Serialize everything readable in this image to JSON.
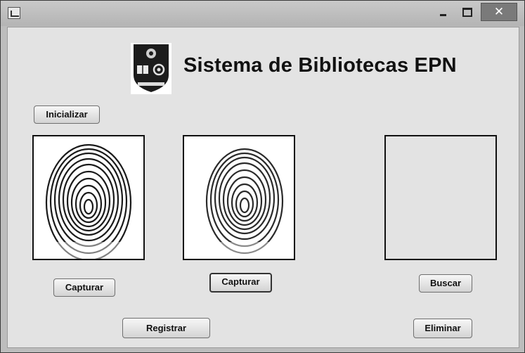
{
  "window": {
    "close_glyph": "✕"
  },
  "header": {
    "title": "Sistema de Bibliotecas EPN"
  },
  "buttons": {
    "initialize": "Inicializar",
    "capture_1": "Capturar",
    "capture_2": "Capturar",
    "search": "Buscar",
    "register": "Registrar",
    "delete": "Eliminar"
  },
  "icons": {
    "app": "java-cup-icon",
    "minimize": "minimize-icon",
    "maximize": "maximize-icon",
    "close": "close-icon",
    "logo": "epn-shield-logo"
  },
  "colors": {
    "window_bg": "#e3e3e3",
    "titlebar": "#bfbfbf",
    "close": "#7a7a7a"
  }
}
